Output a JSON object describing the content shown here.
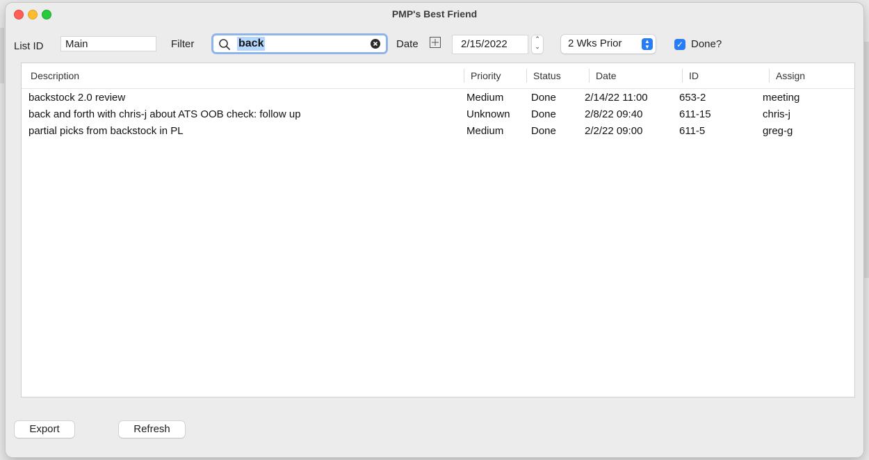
{
  "window": {
    "title": "PMP's Best Friend"
  },
  "toolbar": {
    "list_id_label": "List ID",
    "list_id_value": "Main",
    "filter_label": "Filter",
    "filter_value": "back",
    "date_label": "Date",
    "date_value": "2/15/2022",
    "range_value": "2 Wks Prior",
    "done_label": "Done?",
    "done_checked": true
  },
  "table": {
    "columns": [
      "Description",
      "Priority",
      "Status",
      "Date",
      "ID",
      "Assign"
    ],
    "rows": [
      [
        "backstock 2.0 review",
        "Medium",
        "Done",
        "2/14/22 11:00",
        "653-2",
        "meeting"
      ],
      [
        "back and forth with chris-j about ATS OOB check: follow up",
        "Unknown",
        "Done",
        "2/8/22 09:40",
        "611-15",
        "chris-j"
      ],
      [
        "partial picks from backstock in PL",
        "Medium",
        "Done",
        "2/2/22 09:00",
        "611-5",
        "greg-g"
      ]
    ]
  },
  "footer": {
    "export_label": "Export",
    "refresh_label": "Refresh"
  },
  "colors": {
    "accent": "#2a7cf6",
    "focus_ring": "#8fb4ea",
    "selection": "#b4d7fe"
  }
}
